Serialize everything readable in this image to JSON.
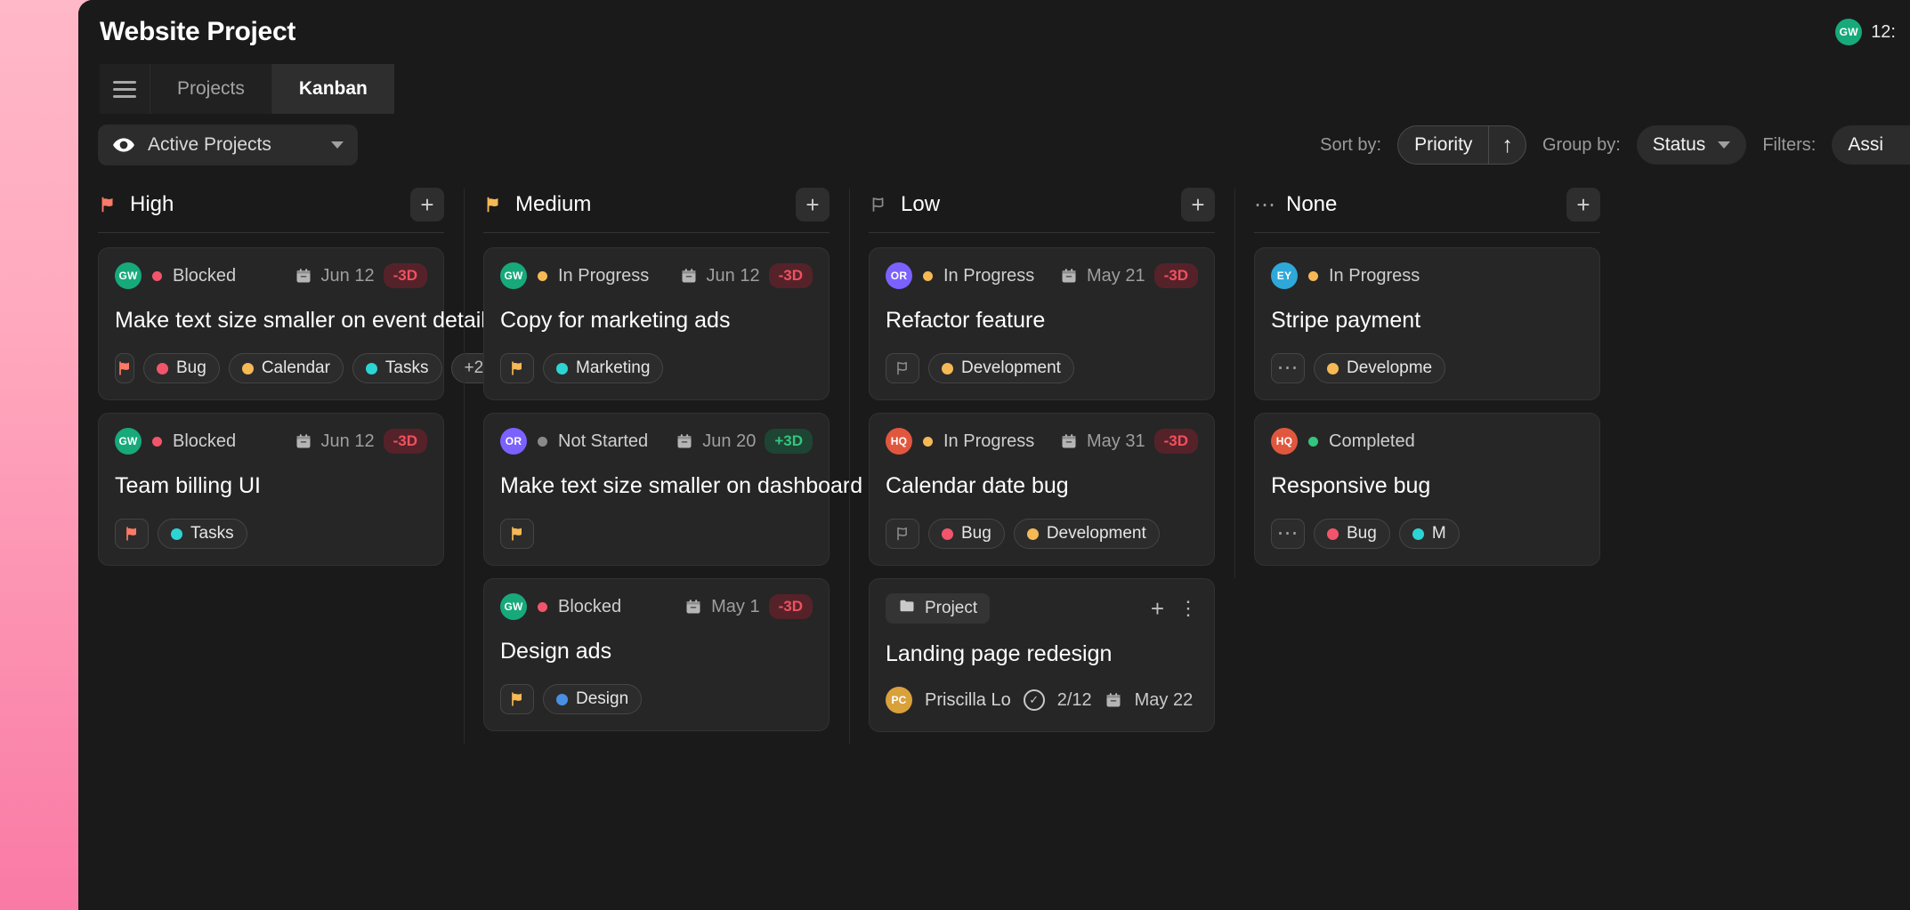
{
  "window": {
    "title": "Website Project",
    "clock": "12:",
    "user_avatar": {
      "initials": "GW",
      "color": "#17A97A"
    }
  },
  "tabs": {
    "menu_icon": "hamburger-icon",
    "items": [
      {
        "label": "Projects",
        "active": false
      },
      {
        "label": "Kanban",
        "active": true
      }
    ]
  },
  "toolbar": {
    "project_filter": {
      "icon": "eye-icon",
      "label": "Active Projects"
    },
    "sort": {
      "label": "Sort by:",
      "value": "Priority",
      "direction_icon": "arrow-up-icon"
    },
    "group": {
      "label": "Group by:",
      "value": "Status"
    },
    "filters": {
      "label": "Filters:",
      "value": "Assi"
    }
  },
  "colors": {
    "flag_high": "#FF7A66",
    "flag_medium": "#F5B955",
    "flag_low": "#8A8A8A",
    "tag_bug": "#F2556B",
    "tag_calendar": "#F5B955",
    "tag_tasks": "#2DD4D4",
    "tag_marketing": "#2DD4D4",
    "tag_development": "#F5B955",
    "tag_design": "#4A90E2",
    "status_blocked": "#F2556B",
    "status_in_progress": "#F5B955",
    "status_not_started": "#8A8A8A",
    "status_completed": "#34C57E"
  },
  "columns": [
    {
      "title": "High",
      "flag": "flag-filled-icon",
      "flag_color": "#FF7A66",
      "add_label": "+",
      "cards": [
        {
          "avatar": {
            "initials": "GW",
            "color": "#17A97A"
          },
          "status": "Blocked",
          "status_color": "#F2556B",
          "date": "Jun 12",
          "daybadge": "-3D",
          "daybadge_type": "neg",
          "title": "Make text size smaller on event details",
          "tags": [
            {
              "label": "",
              "type": "flag",
              "color": "#FF7A66"
            },
            {
              "label": "Bug",
              "color": "#F2556B"
            },
            {
              "label": "Calendar",
              "color": "#F5B955"
            },
            {
              "label": "Tasks",
              "color": "#2DD4D4"
            },
            {
              "label": "+2",
              "type": "more"
            }
          ]
        },
        {
          "avatar": {
            "initials": "GW",
            "color": "#17A97A"
          },
          "status": "Blocked",
          "status_color": "#F2556B",
          "date": "Jun 12",
          "daybadge": "-3D",
          "daybadge_type": "neg",
          "title": "Team billing UI",
          "tags": [
            {
              "label": "",
              "type": "flag",
              "color": "#FF7A66"
            },
            {
              "label": "Tasks",
              "color": "#2DD4D4"
            }
          ]
        }
      ]
    },
    {
      "title": "Medium",
      "flag": "flag-filled-icon",
      "flag_color": "#F5B955",
      "add_label": "+",
      "cards": [
        {
          "avatar": {
            "initials": "GW",
            "color": "#17A97A"
          },
          "status": "In Progress",
          "status_color": "#F5B955",
          "date": "Jun 12",
          "daybadge": "-3D",
          "daybadge_type": "neg",
          "title": "Copy for marketing ads",
          "tags": [
            {
              "label": "",
              "type": "flag",
              "color": "#F5B955"
            },
            {
              "label": "Marketing",
              "color": "#2DD4D4"
            }
          ]
        },
        {
          "avatar": {
            "initials": "OR",
            "color": "#7B61FF"
          },
          "status": "Not Started",
          "status_color": "#8A8A8A",
          "date": "Jun 20",
          "daybadge": "+3D",
          "daybadge_type": "pos",
          "title": "Make text size smaller on dashboard",
          "tags": [
            {
              "label": "",
              "type": "flag",
              "color": "#F5B955"
            }
          ]
        },
        {
          "avatar": {
            "initials": "GW",
            "color": "#17A97A"
          },
          "status": "Blocked",
          "status_color": "#F2556B",
          "date": "May 1",
          "daybadge": "-3D",
          "daybadge_type": "neg",
          "title": "Design ads",
          "tags": [
            {
              "label": "",
              "type": "flag",
              "color": "#F5B955"
            },
            {
              "label": "Design",
              "color": "#4A90E2"
            }
          ]
        }
      ]
    },
    {
      "title": "Low",
      "flag": "flag-outline-icon",
      "flag_color": "#8A8A8A",
      "add_label": "+",
      "cards": [
        {
          "avatar": {
            "initials": "OR",
            "color": "#7B61FF"
          },
          "status": "In Progress",
          "status_color": "#F5B955",
          "date": "May 21",
          "daybadge": "-3D",
          "daybadge_type": "neg",
          "title": "Refactor feature",
          "tags": [
            {
              "label": "",
              "type": "flag-outline",
              "color": "#8A8A8A"
            },
            {
              "label": "Development",
              "color": "#F5B955"
            }
          ]
        },
        {
          "avatar": {
            "initials": "HQ",
            "color": "#E0573E"
          },
          "status": "In Progress",
          "status_color": "#F5B955",
          "date": "May 31",
          "daybadge": "-3D",
          "daybadge_type": "neg",
          "title": "Calendar date bug",
          "tags": [
            {
              "label": "",
              "type": "flag-outline",
              "color": "#8A8A8A"
            },
            {
              "label": "Bug",
              "color": "#F2556B"
            },
            {
              "label": "Development",
              "color": "#F5B955"
            }
          ]
        }
      ],
      "project_card": {
        "folder_label": "Project",
        "folder_icon": "folder-icon",
        "add_icon": "plus-icon",
        "more_icon": "vertical-dots-icon",
        "title": "Landing page redesign",
        "owner": {
          "initials": "PC",
          "color": "#D9A13B",
          "name": "Priscilla Lo"
        },
        "checklist": "2/12",
        "date": "May 22"
      }
    },
    {
      "title": "None",
      "flag": "dots-icon",
      "flag_color": "#9A9A9A",
      "add_label": "+",
      "cards": [
        {
          "avatar": {
            "initials": "EY",
            "color": "#2EA8D8"
          },
          "status": "In Progress",
          "status_color": "#F5B955",
          "date": "",
          "daybadge": "",
          "daybadge_type": "",
          "title": "Stripe payment",
          "tags": [
            {
              "label": "",
              "type": "dots"
            },
            {
              "label": "Developme",
              "color": "#F5B955"
            }
          ]
        },
        {
          "avatar": {
            "initials": "HQ",
            "color": "#E0573E"
          },
          "status": "Completed",
          "status_color": "#34C57E",
          "date": "",
          "daybadge": "",
          "daybadge_type": "",
          "title": "Responsive bug",
          "tags": [
            {
              "label": "",
              "type": "dots"
            },
            {
              "label": "Bug",
              "color": "#F2556B"
            },
            {
              "label": "M",
              "color": "#2DD4D4"
            }
          ]
        }
      ]
    }
  ]
}
